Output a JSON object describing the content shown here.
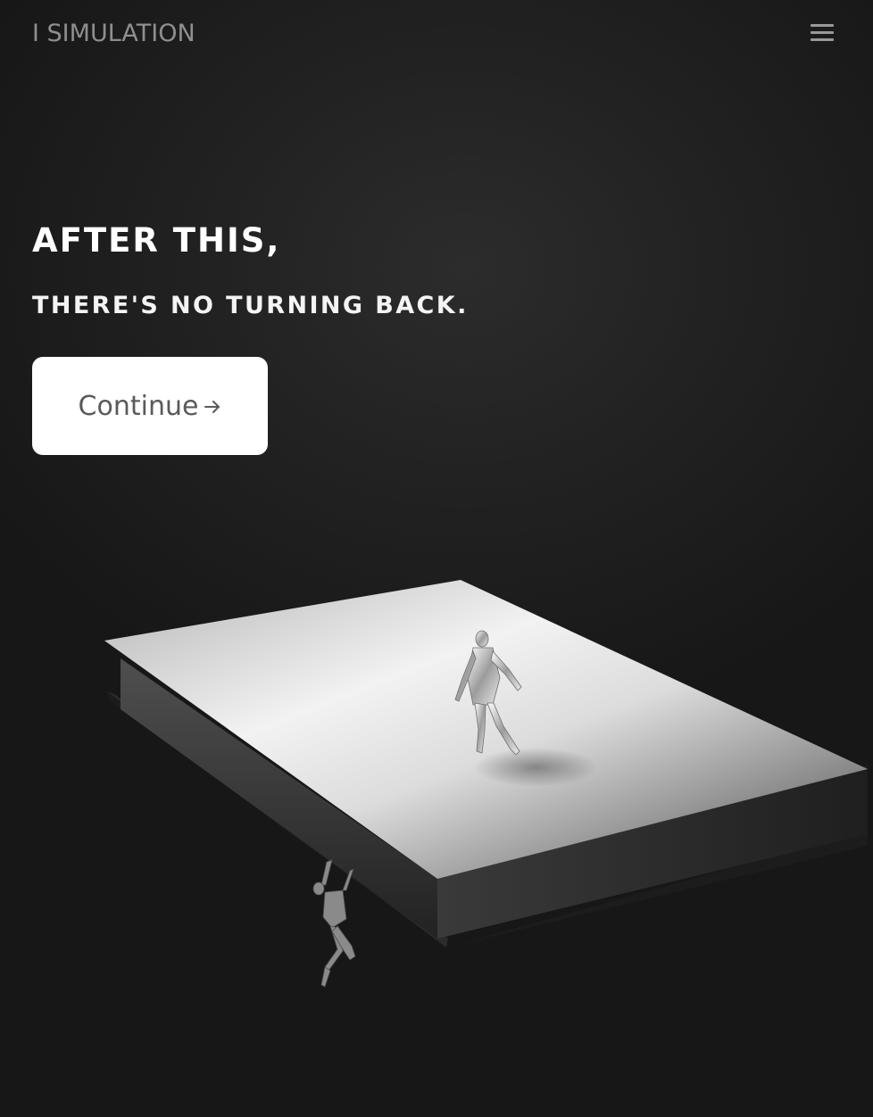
{
  "header": {
    "logo_text": "I SIMULATION",
    "menu_icon": "hamburger-menu-icon"
  },
  "hero": {
    "headline": "AFTER THIS,",
    "subline": "THERE'S NO TURNING BACK.",
    "cta_label": "Continue",
    "cta_icon": "arrow-right-icon"
  },
  "colors": {
    "background": "#1a1a1a",
    "logo": "#8f8f8f",
    "headline": "#ffffff",
    "button_bg": "#ffffff",
    "button_text": "#5a5a5a"
  }
}
